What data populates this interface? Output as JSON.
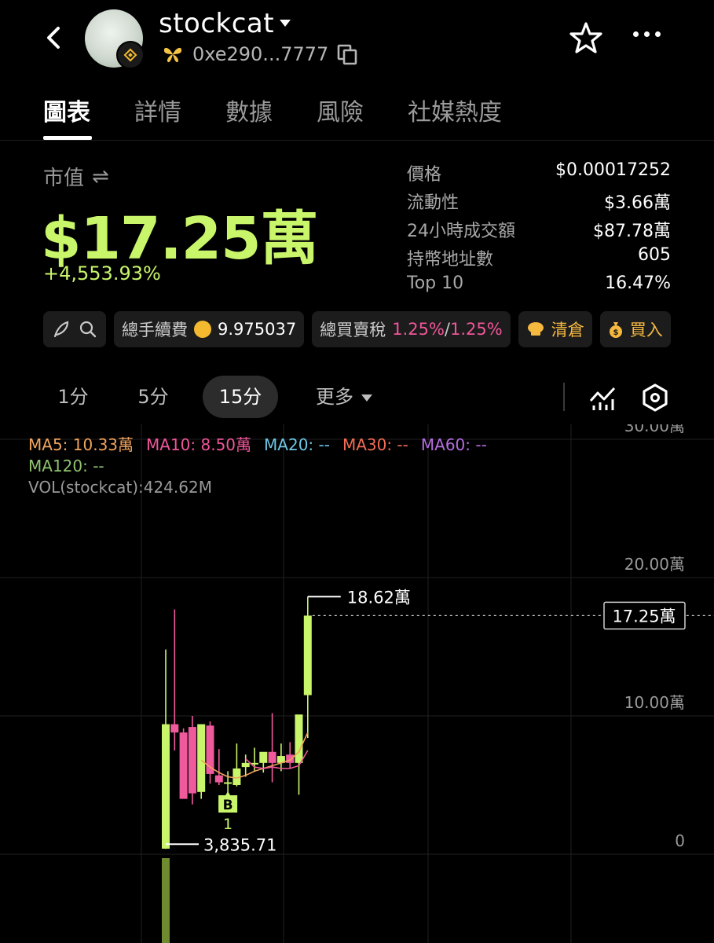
{
  "header": {
    "token_name": "stockcat",
    "address": "0xe290...7777",
    "icons": [
      "back-arrow-icon",
      "avatar",
      "bnb-chain-badge-icon",
      "butterfly-icon",
      "copy-icon",
      "star-icon",
      "more-dots-icon"
    ]
  },
  "tabs": [
    {
      "label": "圖表",
      "active": true
    },
    {
      "label": "詳情",
      "active": false
    },
    {
      "label": "數據",
      "active": false
    },
    {
      "label": "風險",
      "active": false
    },
    {
      "label": "社媒熱度",
      "active": false
    }
  ],
  "market_cap": {
    "label": "市值",
    "swap_icon": "⇌",
    "value": "$17.25萬",
    "change": "+4,553.93%",
    "accent_color": "#c8f56a"
  },
  "stats": [
    {
      "key": "價格",
      "value": "$0.00017252"
    },
    {
      "key": "流動性",
      "value": "$3.66萬"
    },
    {
      "key": "24小時成交額",
      "value": "$87.78萬"
    },
    {
      "key": "持幣地址數",
      "value": "605"
    },
    {
      "key": "Top 10",
      "value": "16.47%"
    }
  ],
  "chips": {
    "fee_label": "總手續費",
    "fee_value": "9.975037",
    "tax_label": "總買賣稅",
    "tax_buy": "1.25%",
    "tax_sep": "/",
    "tax_sell": "1.25%",
    "clear_label": "清倉",
    "buy_label": "買入"
  },
  "intervals": [
    {
      "label": "1分",
      "active": false
    },
    {
      "label": "5分",
      "active": false
    },
    {
      "label": "15分",
      "active": true
    },
    {
      "label": "更多",
      "active": false
    }
  ],
  "legend": {
    "ma5": "MA5: 10.33萬",
    "ma10": "MA10: 8.50萬",
    "ma20": "MA20: --",
    "ma30": "MA30: --",
    "ma60": "MA60: --",
    "ma120": "MA120: --",
    "vol": "VOL(stockcat):424.62M",
    "colors": {
      "ma5": "#f0a35e",
      "ma10": "#f0569a",
      "ma20": "#6fc6e6",
      "ma30": "#f26b55",
      "ma60": "#b46ee0",
      "ma120": "#8fc16e"
    }
  },
  "chart_data": {
    "type": "candlestick",
    "y_ticks": [
      "30.00萬",
      "20.00萬",
      "10.00萬",
      "0"
    ],
    "ylim": [
      0,
      30
    ],
    "current_label": "17.25萬",
    "current_value": 17.25,
    "high_label": "18.62萬",
    "high_value": 18.62,
    "low_label": "3,835.71",
    "low_value": 0.38,
    "marker_letter": "B",
    "marker_count": "1",
    "up_color": "#c8f56a",
    "down_color": "#ef5a9d",
    "candles": [
      {
        "o": 0.4,
        "h": 14.8,
        "l": 0.38,
        "c": 9.4
      },
      {
        "o": 9.4,
        "h": 17.7,
        "l": 7.5,
        "c": 8.8
      },
      {
        "o": 8.8,
        "h": 9.1,
        "l": 4.5,
        "c": 4.0
      },
      {
        "o": 9.2,
        "h": 10.0,
        "l": 3.6,
        "c": 4.4
      },
      {
        "o": 4.5,
        "h": 9.4,
        "l": 4.0,
        "c": 9.4
      },
      {
        "o": 9.3,
        "h": 9.6,
        "l": 5.1,
        "c": 5.8
      },
      {
        "o": 5.7,
        "h": 7.6,
        "l": 5.0,
        "c": 5.2
      },
      {
        "o": 5.2,
        "h": 6.0,
        "l": 4.4,
        "c": 5.2
      },
      {
        "o": 5.0,
        "h": 8.0,
        "l": 4.9,
        "c": 6.2
      },
      {
        "o": 6.3,
        "h": 7.2,
        "l": 5.6,
        "c": 6.6
      },
      {
        "o": 6.5,
        "h": 7.7,
        "l": 6.0,
        "c": 6.6
      },
      {
        "o": 6.6,
        "h": 7.0,
        "l": 5.9,
        "c": 7.4
      },
      {
        "o": 7.4,
        "h": 10.2,
        "l": 5.2,
        "c": 6.6
      },
      {
        "o": 6.6,
        "h": 8.0,
        "l": 6.0,
        "c": 7.1
      },
      {
        "o": 7.2,
        "h": 8.1,
        "l": 6.2,
        "c": 6.6
      },
      {
        "o": 6.6,
        "h": 8.0,
        "l": 4.3,
        "c": 10.1
      },
      {
        "o": 11.5,
        "h": 18.62,
        "l": 8.4,
        "c": 17.25
      }
    ],
    "ma5": [
      null,
      null,
      null,
      null,
      6.8,
      6.3,
      5.9,
      5.6,
      5.5,
      5.7,
      6.0,
      6.2,
      6.4,
      6.6,
      6.8,
      7.4,
      8.8
    ],
    "ma10": [
      null,
      null,
      null,
      null,
      null,
      null,
      null,
      null,
      null,
      6.9,
      6.3,
      6.2,
      6.3,
      6.2,
      6.2,
      6.4,
      7.5
    ],
    "volume": [
      424.62
    ]
  }
}
